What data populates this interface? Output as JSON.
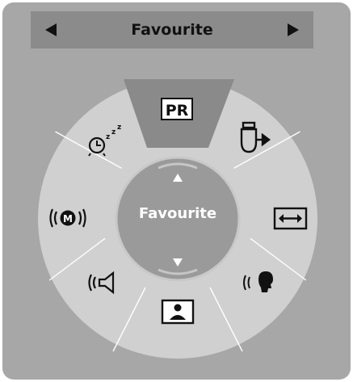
{
  "header": {
    "title": "Favourite",
    "prev_icon": "left-arrow-icon",
    "next_icon": "right-arrow-icon"
  },
  "wheel": {
    "center_label": "Favourite",
    "pr_label": "PR",
    "items": [
      {
        "name": "PR",
        "icon": "pr-icon",
        "selected": true
      },
      {
        "name": "input",
        "icon": "input-icon"
      },
      {
        "name": "aspect-ratio",
        "icon": "aspect-ratio-icon"
      },
      {
        "name": "voice",
        "icon": "voice-icon"
      },
      {
        "name": "picture",
        "icon": "picture-icon"
      },
      {
        "name": "speaker",
        "icon": "speaker-icon"
      },
      {
        "name": "mono-sound",
        "icon": "mono-sound-icon"
      },
      {
        "name": "sleep-timer",
        "icon": "sleep-timer-icon"
      }
    ],
    "colors": {
      "ring": "#d0d0d0",
      "selected_segment": "#8a8a8a",
      "center": "#9a9a9a",
      "icon": "#111111"
    }
  }
}
